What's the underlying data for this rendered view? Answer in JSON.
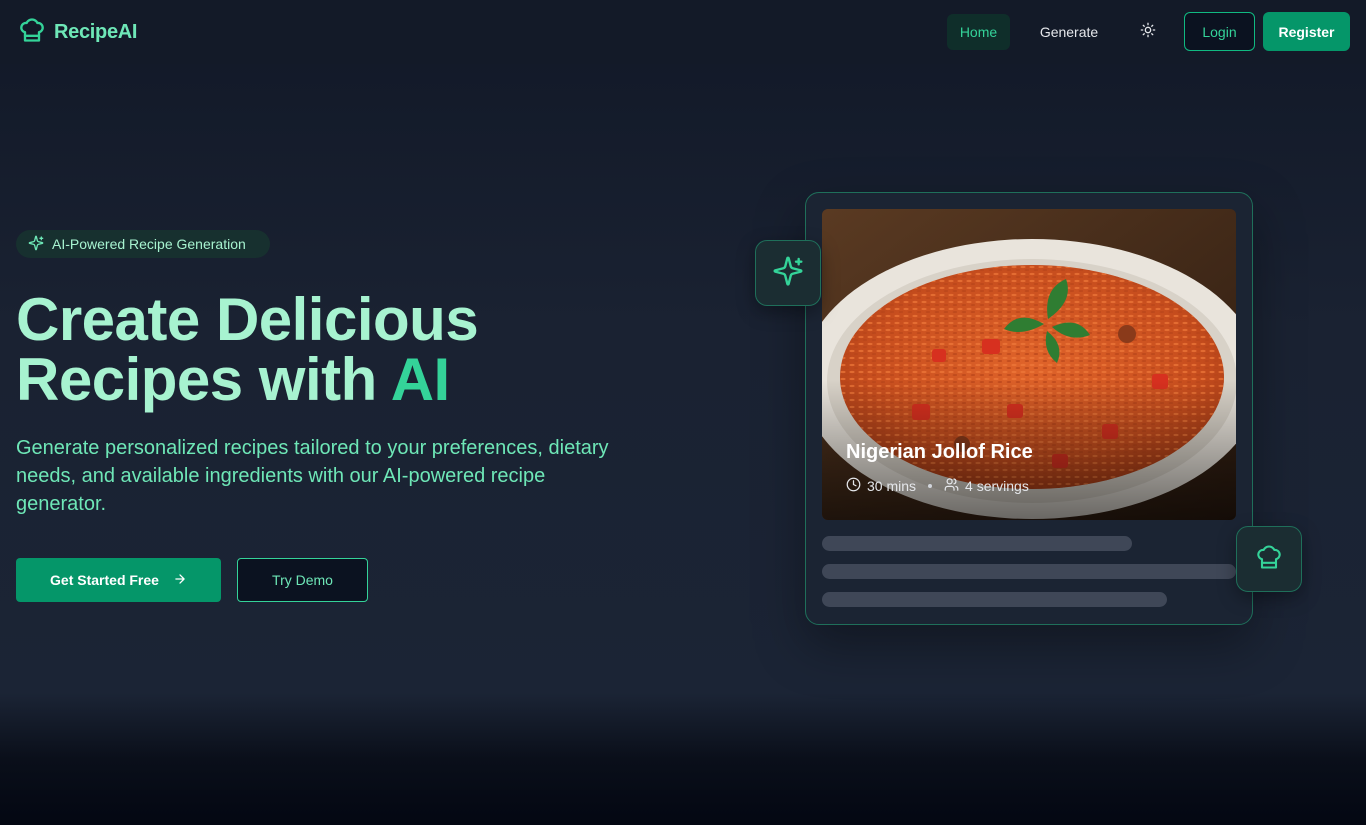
{
  "nav": {
    "brand": "RecipeAI",
    "home": "Home",
    "generate": "Generate",
    "login": "Login",
    "register": "Register"
  },
  "hero": {
    "badge": "AI-Powered Recipe Generation",
    "title_line1": "Create Delicious",
    "title_line2": "Recipes with ",
    "title_accent": "AI",
    "subtitle": "Generate personalized recipes tailored to your preferences, dietary needs, and available ingredients with our AI-powered recipe generator.",
    "cta_primary": "Get Started Free",
    "cta_secondary": "Try Demo"
  },
  "card": {
    "dish_name": "Nigerian Jollof Rice",
    "time": "30 mins",
    "servings": "4 servings"
  },
  "colors": {
    "accent": "#34d399",
    "primary_button": "#059669",
    "title_text": "#a7f3d0",
    "background": "#1b2435"
  },
  "icons": [
    "chef-hat-icon",
    "sun-icon",
    "sparkles-icon",
    "arrow-right-icon",
    "clock-icon",
    "users-icon"
  ]
}
